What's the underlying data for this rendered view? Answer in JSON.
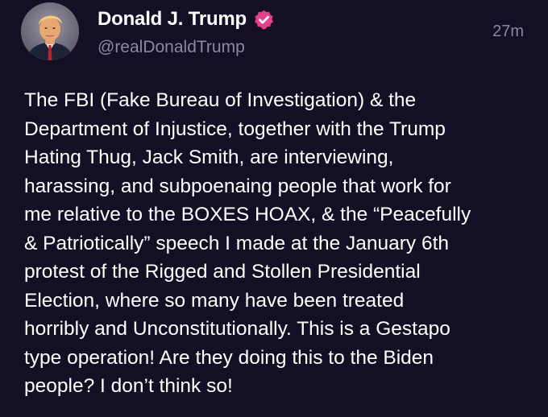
{
  "author": {
    "display_name": "Donald J. Trump",
    "handle": "@realDonaldTrump",
    "verified": true,
    "verified_color": "#e5408a",
    "avatar_icon": "profile-photo"
  },
  "timestamp": "27m",
  "post_text": "The FBI (Fake Bureau of Investigation) & the\nDepartment of Injustice, together with the Trump\nHating Thug, Jack Smith, are interviewing,\nharassing, and subpoenaing people that work for\nme relative to the BOXES HOAX, & the “Peacefully\n& Patriotically” speech I made at the January 6th\nprotest of the Rigged and Stollen Presidential\nElection, where so many have been treated\nhorribly and Unconstitutionally. This is a Gestapo\ntype operation! Are they doing this to the Biden\npeople? I don’t think so!",
  "colors": {
    "background": "#140f25",
    "text": "#ffffff",
    "secondary_text": "#8c87a3"
  }
}
